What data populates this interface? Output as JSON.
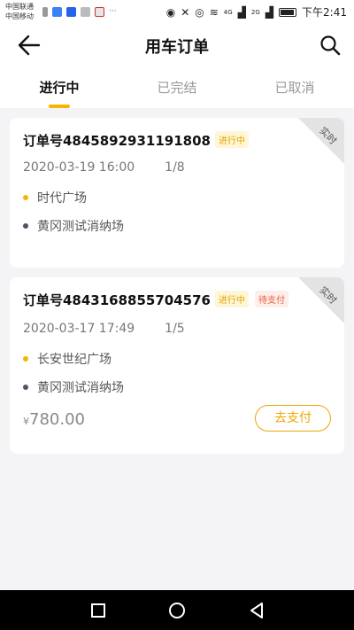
{
  "status_bar": {
    "carrier_1": "中国联通",
    "carrier_2": "中国移动",
    "net_1": "4G",
    "net_2": "2G",
    "time": "下午2:41"
  },
  "header": {
    "title": "用车订单",
    "back_icon": "back-arrow-icon",
    "search_icon": "search-icon"
  },
  "tabs": [
    {
      "label": "进行中",
      "active": true
    },
    {
      "label": "已完结",
      "active": false
    },
    {
      "label": "已取消",
      "active": false
    }
  ],
  "orders": [
    {
      "order_no": "订单号4845892931191808",
      "status_tag": "进行中",
      "corner_label": "实时",
      "datetime": "2020-03-19 16:00",
      "count": "1/8",
      "start": "时代广场",
      "end": "黄冈测试消纳场"
    },
    {
      "order_no": "订单号4843168855704576",
      "status_tag": "进行中",
      "pay_tag": "待支付",
      "corner_label": "实时",
      "datetime": "2020-03-17 17:49",
      "count": "1/5",
      "start": "长安世纪广场",
      "end": "黄冈测试消纳场",
      "price_symbol": "¥",
      "price": "780.00",
      "pay_button": "去支付"
    }
  ],
  "colors": {
    "accent": "#f4b400",
    "pay": "#f0a500",
    "unpaid": "#e8603a"
  }
}
